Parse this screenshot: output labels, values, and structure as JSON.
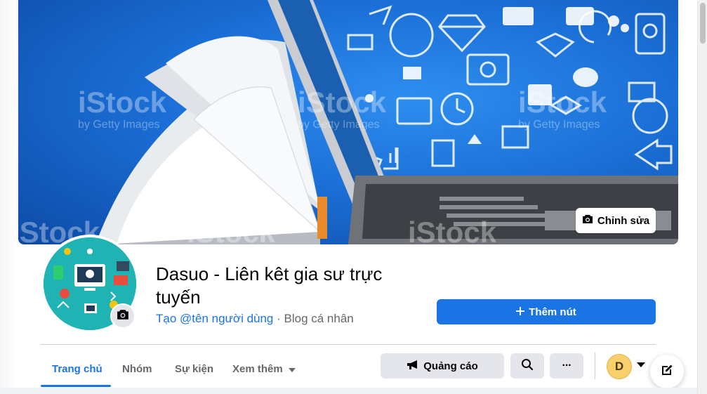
{
  "cover": {
    "edit_label": "Chỉnh sửa",
    "watermark": "iStock",
    "watermark_sub": "by Getty Images"
  },
  "profile": {
    "name": "Dasuo - Liên kêt gia sư trực tuyến",
    "create_username": "Tạo @tên người dùng",
    "separator": " · ",
    "category": "Blog cá nhân"
  },
  "actions": {
    "add_button": "Thêm nút",
    "ads_button": "Quảng cáo",
    "more_glyph": "···"
  },
  "tabs": [
    {
      "label": "Trang chủ",
      "active": true
    },
    {
      "label": "Nhóm",
      "active": false
    },
    {
      "label": "Sự kiện",
      "active": false
    },
    {
      "label": "Xem thêm",
      "active": false
    }
  ],
  "account": {
    "initial": "D"
  },
  "colors": {
    "accent": "#1b74e4",
    "button_gray": "#e4e6eb",
    "avatar_bg": "#1fb3b3",
    "cover_blue": "#1b6fd6"
  },
  "icons": [
    "camera-icon",
    "plus-icon",
    "megaphone-icon",
    "search-icon",
    "more-icon",
    "caret-down-icon",
    "compose-icon"
  ]
}
